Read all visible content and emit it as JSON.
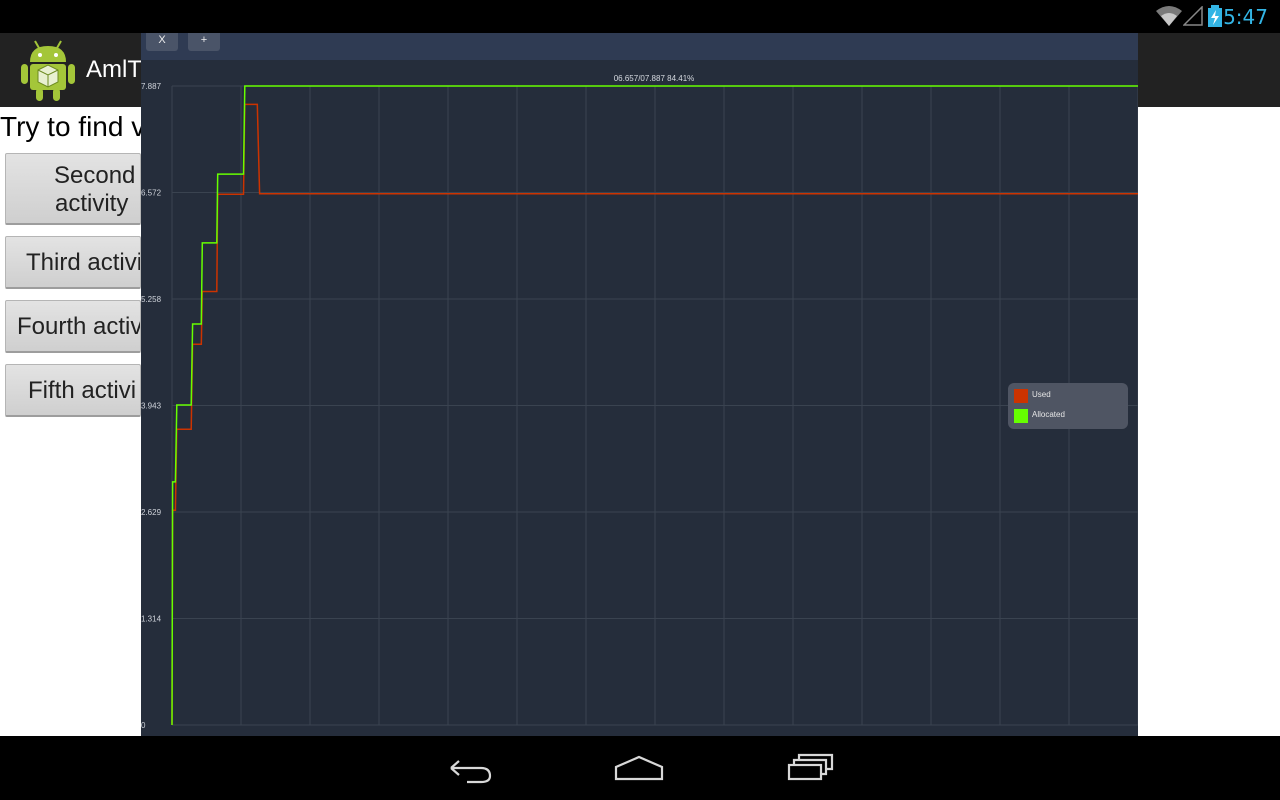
{
  "status_bar": {
    "time": "5:47",
    "wifi_icon": "wifi-icon",
    "signal_icon": "cell-signal-icon",
    "battery_icon": "battery-charging-icon"
  },
  "app": {
    "title": "AmlT",
    "icon": "android-robot-icon",
    "prompt": "Try to find v",
    "buttons": [
      {
        "label_line1": "Second",
        "label_line2": "activity"
      },
      {
        "label": "Third activi"
      },
      {
        "label": "Fourth activ"
      },
      {
        "label": "Fifth activi"
      }
    ]
  },
  "overlay": {
    "close_label": "X",
    "add_label": "+",
    "legend": [
      {
        "name": "Used",
        "color": "#cc3300"
      },
      {
        "name": "Allocated",
        "color": "#66ff00"
      }
    ]
  },
  "chart_data": {
    "type": "line",
    "title": "06.657/07.887 84.41%",
    "ylim": [
      0,
      7.887
    ],
    "y_ticks": [
      "7.887",
      "6.572",
      "5.258",
      "3.943",
      "2.629",
      "1.314",
      "0"
    ],
    "x_gridlines": 14,
    "grid": true,
    "legend_position": "right",
    "x": [
      0,
      0.2,
      1.05,
      1.5,
      4.95,
      5.2,
      5.95,
      6.4,
      9.1,
      9.4,
      10.3,
      10.7,
      13.65,
      13.9,
      14.2,
      14.6,
      18.6,
      18.9,
      19.55,
      19.85,
      22.2,
      22.6,
      24.6,
      26.5,
      27.2,
      30,
      40,
      50,
      60,
      70,
      80,
      90,
      98,
      100,
      110,
      120,
      130,
      140,
      150,
      160,
      170,
      180,
      190,
      200,
      210,
      220,
      230,
      240,
      250,
      260,
      270,
      280,
      290,
      300
    ],
    "series": [
      {
        "name": "Used",
        "color": "#cc3300",
        "values": [
          0,
          2.65,
          2.65,
          3.65,
          3.65,
          3.65,
          3.65,
          4.7,
          4.7,
          5.35,
          5.35,
          5.35,
          5.35,
          5.35,
          6.55,
          6.55,
          6.55,
          6.55,
          6.55,
          6.55,
          6.55,
          7.66,
          7.66,
          7.66,
          6.557,
          6.557,
          6.557,
          6.557,
          6.557,
          6.557,
          6.557,
          6.557,
          6.557,
          6.557,
          6.557,
          6.557,
          6.557,
          6.557,
          6.557,
          6.557,
          6.557,
          6.557,
          6.557,
          6.557,
          6.557,
          6.557,
          6.557,
          6.557,
          6.557,
          6.557,
          6.557,
          6.557,
          6.557,
          6.557
        ]
      },
      {
        "name": "Allocated",
        "color": "#66ff00",
        "values": [
          0,
          3.0,
          3.0,
          3.95,
          3.95,
          3.95,
          3.95,
          4.95,
          4.95,
          5.95,
          5.95,
          5.95,
          5.95,
          5.95,
          6.8,
          6.8,
          6.8,
          6.8,
          6.8,
          6.8,
          6.8,
          7.887,
          7.887,
          7.887,
          7.887,
          7.887,
          7.887,
          7.887,
          7.887,
          7.887,
          7.887,
          7.887,
          7.887,
          7.887,
          7.887,
          7.887,
          7.887,
          7.887,
          7.887,
          7.887,
          7.887,
          7.887,
          7.887,
          7.887,
          7.887,
          7.887,
          7.887,
          7.887,
          7.887,
          7.887,
          7.887,
          7.887,
          7.887,
          7.887
        ]
      }
    ]
  },
  "nav_bar": {
    "back_icon": "back-icon",
    "home_icon": "home-icon",
    "recents_icon": "recent-apps-icon"
  }
}
